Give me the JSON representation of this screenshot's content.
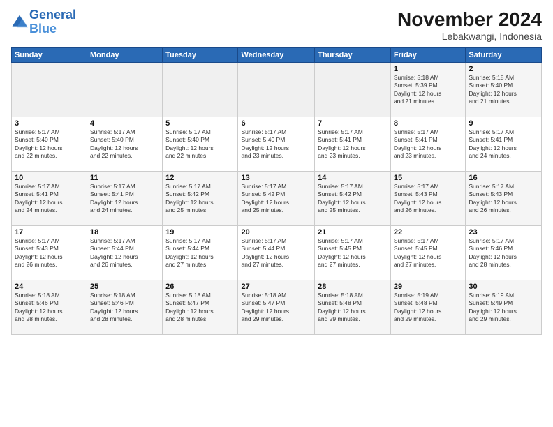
{
  "logo": {
    "line1": "General",
    "line2": "Blue"
  },
  "title": "November 2024",
  "location": "Lebakwangi, Indonesia",
  "days_of_week": [
    "Sunday",
    "Monday",
    "Tuesday",
    "Wednesday",
    "Thursday",
    "Friday",
    "Saturday"
  ],
  "weeks": [
    [
      {
        "day": "",
        "info": ""
      },
      {
        "day": "",
        "info": ""
      },
      {
        "day": "",
        "info": ""
      },
      {
        "day": "",
        "info": ""
      },
      {
        "day": "",
        "info": ""
      },
      {
        "day": "1",
        "info": "Sunrise: 5:18 AM\nSunset: 5:39 PM\nDaylight: 12 hours\nand 21 minutes."
      },
      {
        "day": "2",
        "info": "Sunrise: 5:18 AM\nSunset: 5:40 PM\nDaylight: 12 hours\nand 21 minutes."
      }
    ],
    [
      {
        "day": "3",
        "info": "Sunrise: 5:17 AM\nSunset: 5:40 PM\nDaylight: 12 hours\nand 22 minutes."
      },
      {
        "day": "4",
        "info": "Sunrise: 5:17 AM\nSunset: 5:40 PM\nDaylight: 12 hours\nand 22 minutes."
      },
      {
        "day": "5",
        "info": "Sunrise: 5:17 AM\nSunset: 5:40 PM\nDaylight: 12 hours\nand 22 minutes."
      },
      {
        "day": "6",
        "info": "Sunrise: 5:17 AM\nSunset: 5:40 PM\nDaylight: 12 hours\nand 23 minutes."
      },
      {
        "day": "7",
        "info": "Sunrise: 5:17 AM\nSunset: 5:41 PM\nDaylight: 12 hours\nand 23 minutes."
      },
      {
        "day": "8",
        "info": "Sunrise: 5:17 AM\nSunset: 5:41 PM\nDaylight: 12 hours\nand 23 minutes."
      },
      {
        "day": "9",
        "info": "Sunrise: 5:17 AM\nSunset: 5:41 PM\nDaylight: 12 hours\nand 24 minutes."
      }
    ],
    [
      {
        "day": "10",
        "info": "Sunrise: 5:17 AM\nSunset: 5:41 PM\nDaylight: 12 hours\nand 24 minutes."
      },
      {
        "day": "11",
        "info": "Sunrise: 5:17 AM\nSunset: 5:41 PM\nDaylight: 12 hours\nand 24 minutes."
      },
      {
        "day": "12",
        "info": "Sunrise: 5:17 AM\nSunset: 5:42 PM\nDaylight: 12 hours\nand 25 minutes."
      },
      {
        "day": "13",
        "info": "Sunrise: 5:17 AM\nSunset: 5:42 PM\nDaylight: 12 hours\nand 25 minutes."
      },
      {
        "day": "14",
        "info": "Sunrise: 5:17 AM\nSunset: 5:42 PM\nDaylight: 12 hours\nand 25 minutes."
      },
      {
        "day": "15",
        "info": "Sunrise: 5:17 AM\nSunset: 5:43 PM\nDaylight: 12 hours\nand 26 minutes."
      },
      {
        "day": "16",
        "info": "Sunrise: 5:17 AM\nSunset: 5:43 PM\nDaylight: 12 hours\nand 26 minutes."
      }
    ],
    [
      {
        "day": "17",
        "info": "Sunrise: 5:17 AM\nSunset: 5:43 PM\nDaylight: 12 hours\nand 26 minutes."
      },
      {
        "day": "18",
        "info": "Sunrise: 5:17 AM\nSunset: 5:44 PM\nDaylight: 12 hours\nand 26 minutes."
      },
      {
        "day": "19",
        "info": "Sunrise: 5:17 AM\nSunset: 5:44 PM\nDaylight: 12 hours\nand 27 minutes."
      },
      {
        "day": "20",
        "info": "Sunrise: 5:17 AM\nSunset: 5:44 PM\nDaylight: 12 hours\nand 27 minutes."
      },
      {
        "day": "21",
        "info": "Sunrise: 5:17 AM\nSunset: 5:45 PM\nDaylight: 12 hours\nand 27 minutes."
      },
      {
        "day": "22",
        "info": "Sunrise: 5:17 AM\nSunset: 5:45 PM\nDaylight: 12 hours\nand 27 minutes."
      },
      {
        "day": "23",
        "info": "Sunrise: 5:17 AM\nSunset: 5:46 PM\nDaylight: 12 hours\nand 28 minutes."
      }
    ],
    [
      {
        "day": "24",
        "info": "Sunrise: 5:18 AM\nSunset: 5:46 PM\nDaylight: 12 hours\nand 28 minutes."
      },
      {
        "day": "25",
        "info": "Sunrise: 5:18 AM\nSunset: 5:46 PM\nDaylight: 12 hours\nand 28 minutes."
      },
      {
        "day": "26",
        "info": "Sunrise: 5:18 AM\nSunset: 5:47 PM\nDaylight: 12 hours\nand 28 minutes."
      },
      {
        "day": "27",
        "info": "Sunrise: 5:18 AM\nSunset: 5:47 PM\nDaylight: 12 hours\nand 29 minutes."
      },
      {
        "day": "28",
        "info": "Sunrise: 5:18 AM\nSunset: 5:48 PM\nDaylight: 12 hours\nand 29 minutes."
      },
      {
        "day": "29",
        "info": "Sunrise: 5:19 AM\nSunset: 5:48 PM\nDaylight: 12 hours\nand 29 minutes."
      },
      {
        "day": "30",
        "info": "Sunrise: 5:19 AM\nSunset: 5:49 PM\nDaylight: 12 hours\nand 29 minutes."
      }
    ]
  ]
}
